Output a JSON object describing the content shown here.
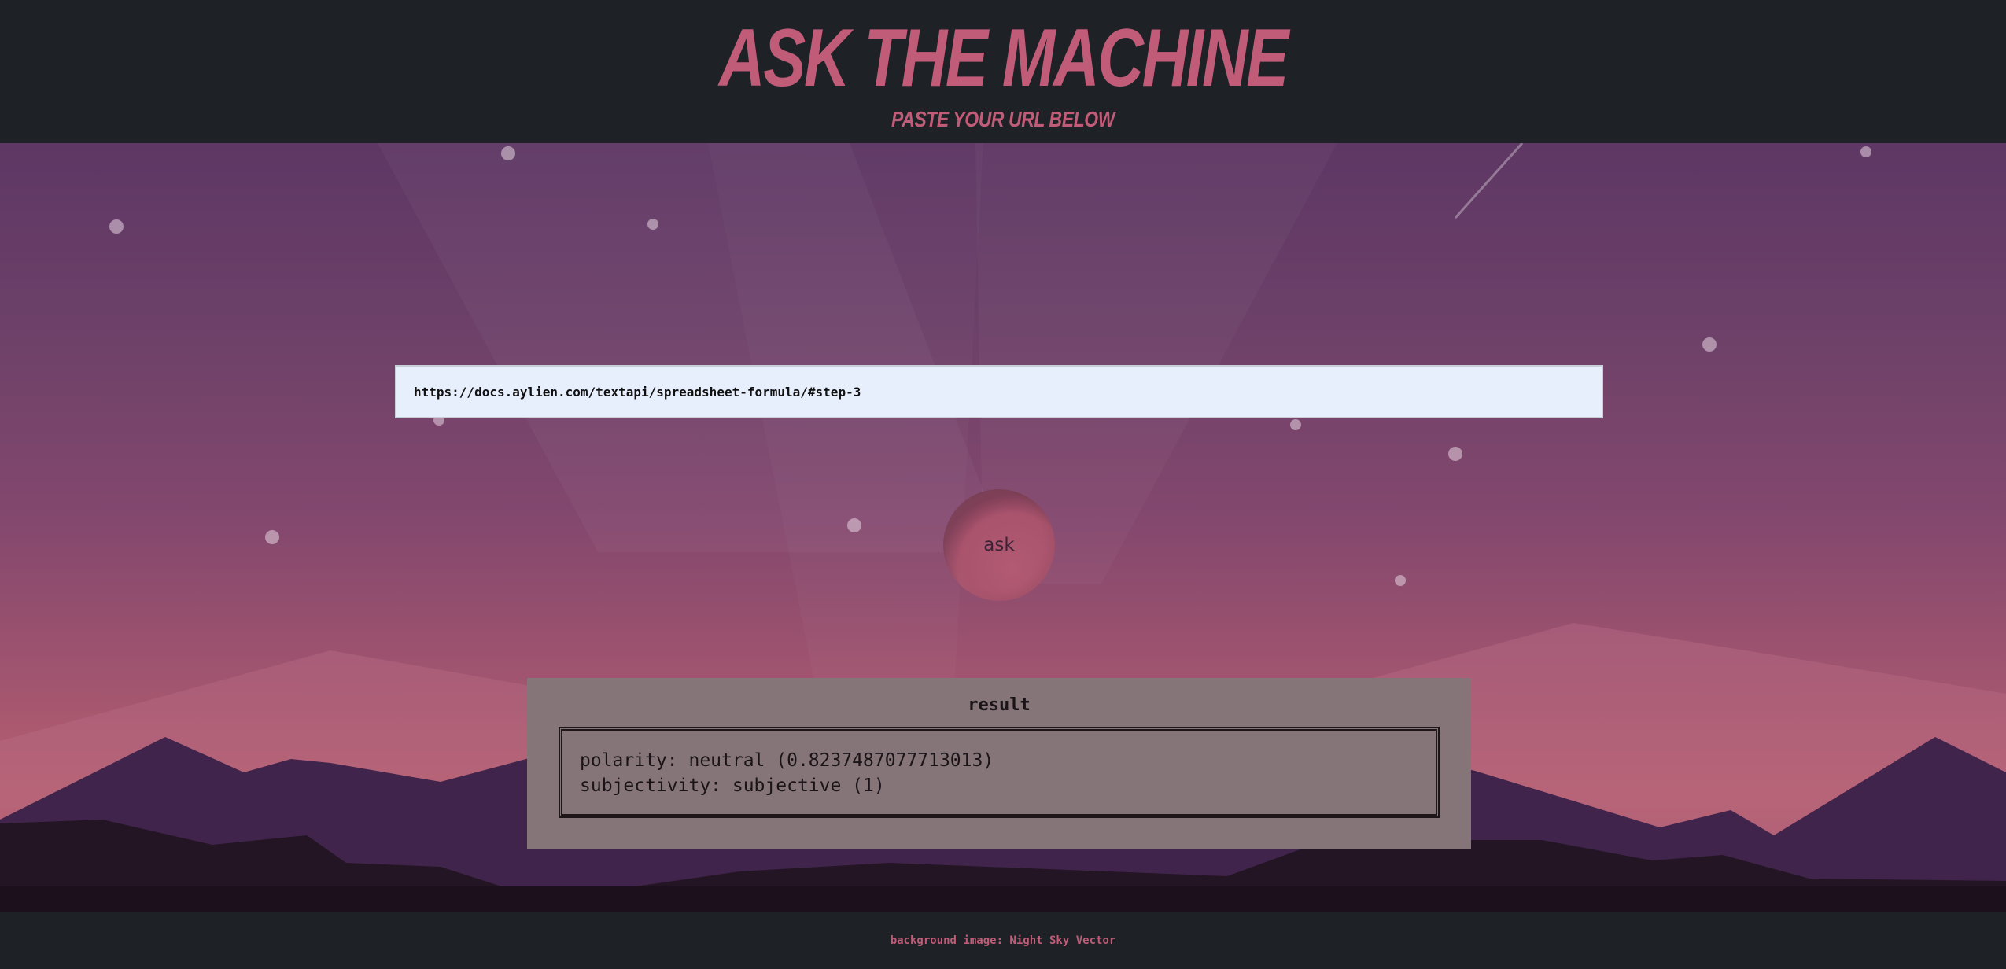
{
  "header": {
    "title": "ASK THE MACHINE",
    "subtitle": "PASTE YOUR URL BELOW"
  },
  "form": {
    "url_value": "https://docs.aylien.com/textapi/spreadsheet-formula/#step-3",
    "ask_label": "ask"
  },
  "result": {
    "heading": "result",
    "lines": [
      "polarity: neutral (0.8237487077713013)",
      "subjectivity: subjective (1)"
    ]
  },
  "footer": {
    "credit": "background image: Night Sky Vector"
  },
  "colors": {
    "accent": "#c05c78",
    "header_bg": "#1e2226",
    "input_bg": "#e8effc",
    "result_bg": "#857578",
    "sky_top": "#5e3764",
    "sky_bottom": "#b8606f"
  },
  "icons": [
    "stars",
    "mountains",
    "shooting-star"
  ]
}
